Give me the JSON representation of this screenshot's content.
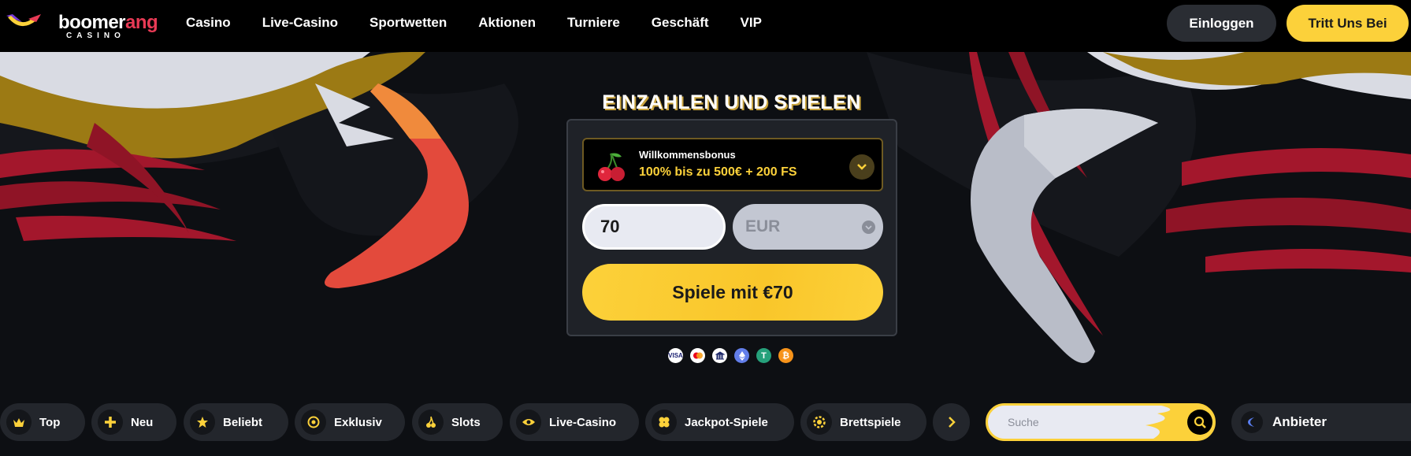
{
  "header": {
    "logo": {
      "text_main": "boomer",
      "text_accent": "ang",
      "text_sub": "CASINO"
    },
    "nav": [
      "Casino",
      "Live-Casino",
      "Sportwetten",
      "Aktionen",
      "Turniere",
      "Geschäft",
      "VIP"
    ],
    "login_label": "Einloggen",
    "join_label": "Tritt Uns Bei"
  },
  "hero": {
    "title": "EINZAHLEN UND SPIELEN",
    "bonus": {
      "label": "Willkommensbonus",
      "offer": "100% bis zu 500€ + 200 FS"
    },
    "amount_value": "70",
    "currency_value": "EUR",
    "play_label": "Spiele mit €70",
    "payment_methods": [
      "visa-icon",
      "mastercard-icon",
      "bank-icon",
      "ethereum-icon",
      "tether-icon",
      "bitcoin-icon"
    ]
  },
  "categories": [
    {
      "name": "top",
      "label": "Top",
      "icon": "crown-icon"
    },
    {
      "name": "new",
      "label": "Neu",
      "icon": "plus-icon"
    },
    {
      "name": "popular",
      "label": "Beliebt",
      "icon": "star-icon"
    },
    {
      "name": "exclusive",
      "label": "Exklusiv",
      "icon": "exclusive-icon"
    },
    {
      "name": "slots",
      "label": "Slots",
      "icon": "cherry-icon"
    },
    {
      "name": "live-casino",
      "label": "Live-Casino",
      "icon": "eye-icon"
    },
    {
      "name": "jackpot",
      "label": "Jackpot-Spiele",
      "icon": "clover-icon"
    },
    {
      "name": "board",
      "label": "Brettspiele",
      "icon": "chip-icon"
    }
  ],
  "search": {
    "placeholder": "Suche"
  },
  "provider_label": "Anbieter",
  "colors": {
    "accent": "#fcd13a",
    "brand_red": "#e83a55",
    "background": "#0c0e12",
    "panel": "#23262c"
  }
}
